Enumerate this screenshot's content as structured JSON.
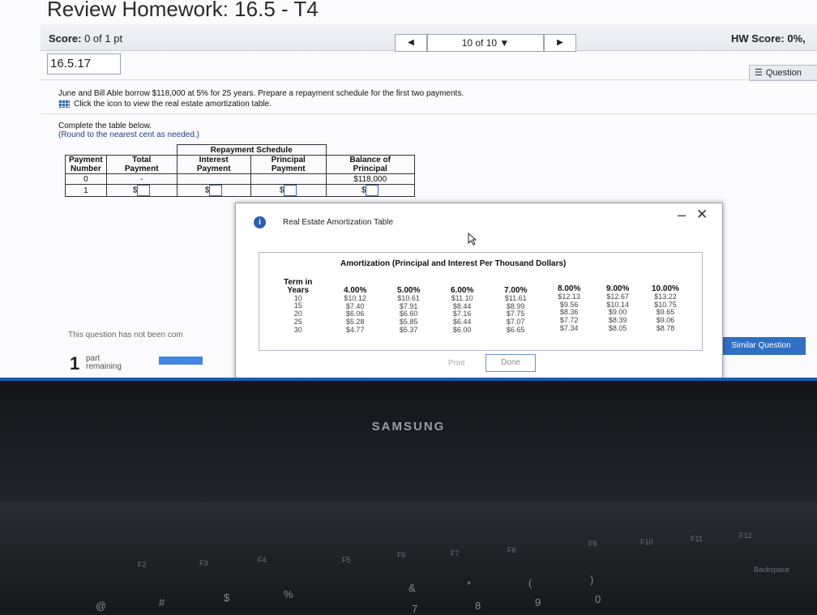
{
  "header": {
    "title": "Review Homework: 16.5 - T4",
    "score_label": "Score:",
    "score_value": "0 of 1 pt",
    "position": "10 of 10 ▼",
    "hw_score": "HW Score: 0%,",
    "question_number": "16.5.17",
    "question_button": "Question"
  },
  "problem": {
    "text": "June and Bill Able borrow $118,000 at 5% for 25 years. Prepare a repayment schedule for the first two payments.",
    "icon_link": "Click the icon to view the real estate amortization table."
  },
  "instructions": {
    "line1": "Complete the table below.",
    "line2": "(Round to the nearest cent as needed.)"
  },
  "schedule": {
    "caption": "Repayment Schedule",
    "headers": {
      "payment_number": [
        "Payment",
        "Number"
      ],
      "total_payment": [
        "Total",
        "Payment"
      ],
      "interest_payment": [
        "Interest",
        "Payment"
      ],
      "principal_payment": [
        "Principal",
        "Payment"
      ],
      "balance": [
        "Balance of",
        "Principal"
      ]
    },
    "row0": {
      "payment_number": "0",
      "total_payment": "-",
      "balance": "$118,000"
    },
    "row1": {
      "payment_number": "1",
      "currency": "$"
    }
  },
  "status": {
    "not_been": "This question has not been com",
    "part_count": "1",
    "part_label": "part",
    "remaining": "remaining",
    "similar_question": "Similar Question"
  },
  "modal": {
    "title": "Real Estate Amortization Table",
    "table_title": "Amortization (Principal and Interest Per Thousand Dollars)",
    "term_header": [
      "Term in",
      "Years"
    ],
    "terms": [
      "10",
      "15",
      "20",
      "25",
      "30"
    ],
    "rates": [
      {
        "rate": "4.00%",
        "values": [
          "$10.12",
          "$7.40",
          "$6.06",
          "$5.28",
          "$4.77"
        ]
      },
      {
        "rate": "5.00%",
        "values": [
          "$10.61",
          "$7.91",
          "$6.60",
          "$5.85",
          "$5.37"
        ]
      },
      {
        "rate": "6.00%",
        "values": [
          "$11.10",
          "$8.44",
          "$7.16",
          "$6.44",
          "$6.00"
        ]
      },
      {
        "rate": "7.00%",
        "values": [
          "$11.61",
          "$8.99",
          "$7.75",
          "$7.07",
          "$6.65"
        ]
      },
      {
        "rate": "8.00%",
        "values": [
          "$12.13",
          "$9.56",
          "$8.36",
          "$7.72",
          "$7.34"
        ]
      },
      {
        "rate": "9.00%",
        "values": [
          "$12.67",
          "$10.14",
          "$9.00",
          "$8.39",
          "$8.05"
        ]
      },
      {
        "rate": "10.00%",
        "values": [
          "$13.22",
          "$10.75",
          "$9.65",
          "$9.06",
          "$8.78"
        ]
      }
    ],
    "print": "Print",
    "done": "Done"
  },
  "laptop": {
    "brand": "SAMSUNG",
    "keys": [
      "F2",
      "F3",
      "F4",
      "F5",
      "F6",
      "F7",
      "F8",
      "F9",
      "F10",
      "F11",
      "F12",
      "Backspace",
      "%",
      "&",
      "*",
      "(",
      ")",
      "7",
      "8",
      "9",
      "0",
      "#",
      "$",
      "@"
    ]
  }
}
